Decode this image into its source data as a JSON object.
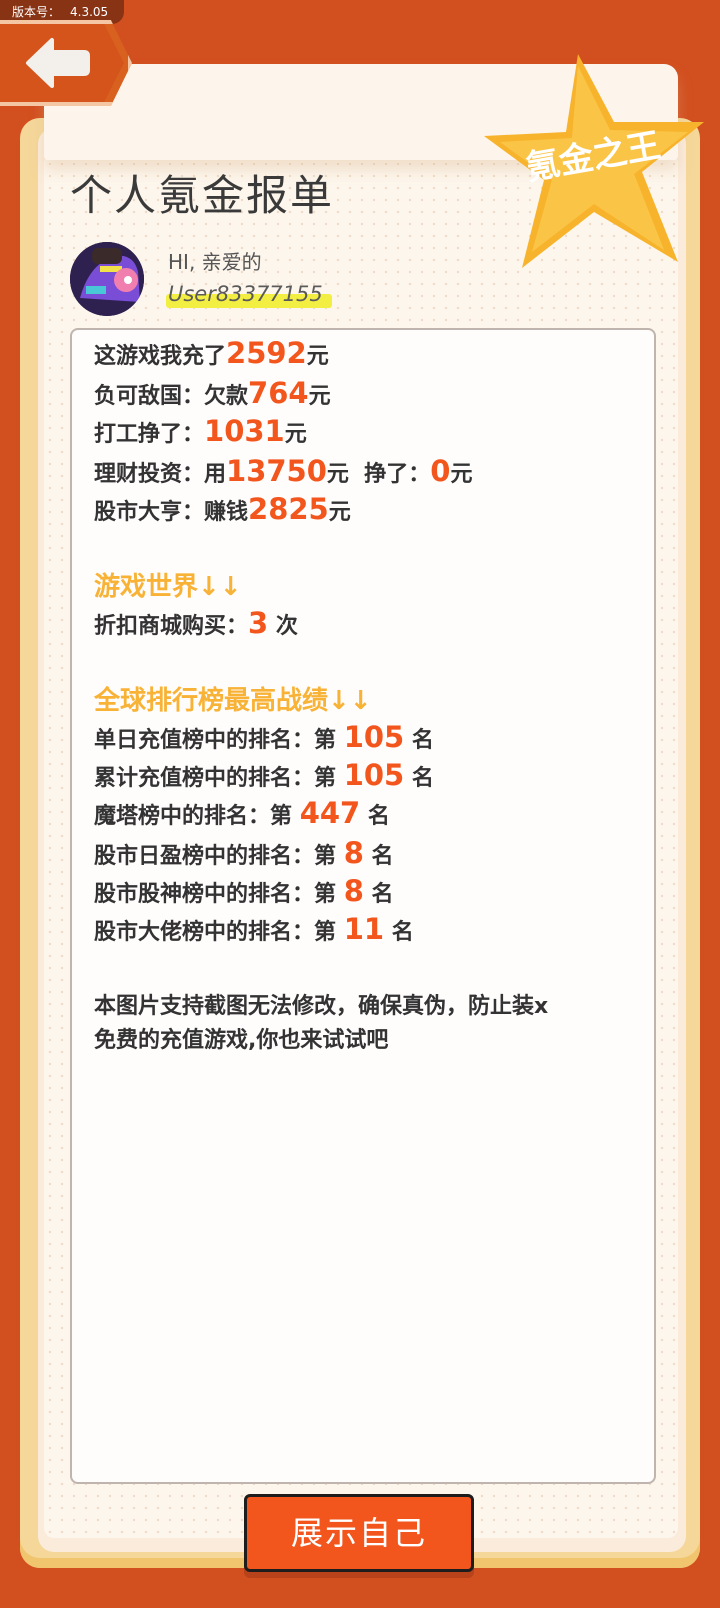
{
  "version": {
    "label": "版本号：",
    "value": "4.3.05"
  },
  "header": {
    "badge_text": "氪金之王"
  },
  "page": {
    "title": "个人氪金报单"
  },
  "user": {
    "greeting": "HI, 亲爱的",
    "username": "User83377155"
  },
  "stats": [
    {
      "label": "这游戏我充了",
      "value": "2592",
      "unit": "元"
    },
    {
      "label": "负可敌国：欠款",
      "value": "764",
      "unit": "元"
    },
    {
      "label": "打工挣了：",
      "value": "1031",
      "unit": "元"
    },
    {
      "label": "理财投资：用",
      "value": "13750",
      "unit": "元",
      "label2": "挣了：",
      "value2": "0",
      "unit2": "元"
    },
    {
      "label": "股市大亨：赚钱",
      "value": "2825",
      "unit": "元"
    }
  ],
  "game_world": {
    "heading": "游戏世界↓↓",
    "shop": {
      "label": "折扣商城购买：",
      "value": "3",
      "unit": "次"
    }
  },
  "rankings": {
    "heading": "全球排行榜最高战绩↓↓",
    "items": [
      {
        "label": "单日充值榜中的排名：第",
        "value": "105",
        "unit": "名"
      },
      {
        "label": "累计充值榜中的排名：第",
        "value": "105",
        "unit": "名"
      },
      {
        "label": "魔塔榜中的排名：第",
        "value": "447",
        "unit": "名"
      },
      {
        "label": "股市日盈榜中的排名：第",
        "value": "8",
        "unit": "名"
      },
      {
        "label": "股市股神榜中的排名：第",
        "value": "8",
        "unit": "名"
      },
      {
        "label": "股市大佬榜中的排名：第",
        "value": "11",
        "unit": "名"
      }
    ]
  },
  "note": {
    "line1": "本图片支持截图无法修改，确保真伪，防止装x",
    "line2": "免费的充值游戏,你也来试试吧"
  },
  "actions": {
    "show_label": "展示自己"
  },
  "colors": {
    "accent": "#F2561D",
    "heading": "#F8B236",
    "frame": "#D24F1F"
  }
}
